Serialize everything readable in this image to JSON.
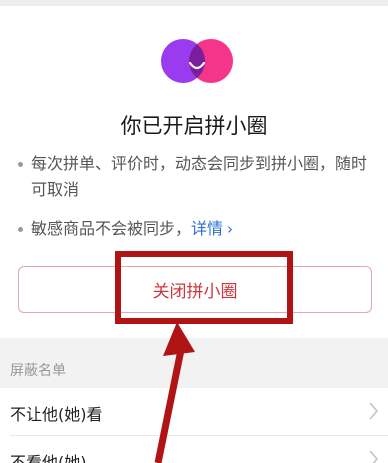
{
  "page": {
    "title": "你已开启拼小圈",
    "bullets": [
      "每次拼单、评价时，动态会同步到拼小圈，随时可取消",
      "敏感商品不会被同步，"
    ],
    "details_link": "详情",
    "details_chevron": "›",
    "close_button_label": "关闭拼小圈"
  },
  "block_list": {
    "header": "屏蔽名单",
    "rows": [
      {
        "label": "不让他(她)看"
      },
      {
        "label": "不看他(她)"
      }
    ]
  },
  "icons": {
    "logo": "pinxiaoquan-logo",
    "row_chevron": "chevron-right-icon"
  },
  "colors": {
    "logo_left": "#9b3bf0",
    "logo_right": "#f5358a",
    "logo_overlap": "#7a1e9e",
    "link": "#2b6ed2",
    "close_text": "#d0363c",
    "annotation": "#b01414"
  }
}
